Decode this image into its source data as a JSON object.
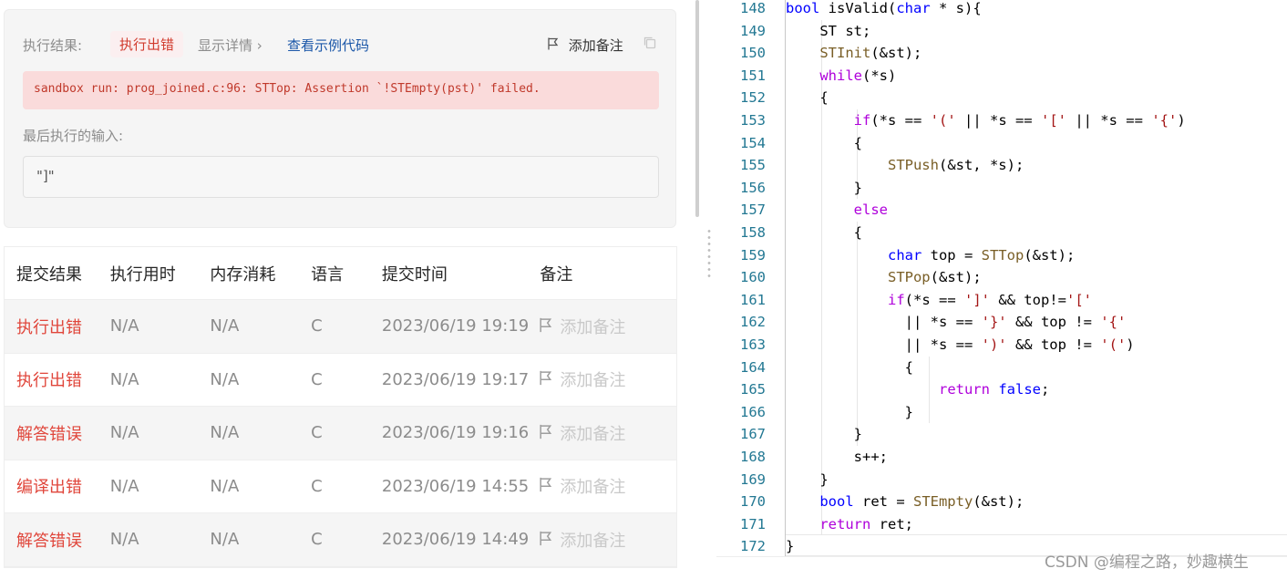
{
  "result": {
    "label": "执行结果:",
    "status": "执行出错",
    "detail": "显示详情",
    "example": "查看示例代码",
    "add_note": "添加备注",
    "error_message": "sandbox run: prog_joined.c:96: STTop: Assertion `!STEmpty(pst)' failed.",
    "last_input_label": "最后执行的输入:",
    "last_input_value": "\"]\""
  },
  "table": {
    "headers": [
      "提交结果",
      "执行用时",
      "内存消耗",
      "语言",
      "提交时间",
      "备注"
    ],
    "rows": [
      {
        "result": "执行出错",
        "time": "N/A",
        "memory": "N/A",
        "lang": "C",
        "submitted": "2023/06/19 19:19",
        "note": "添加备注"
      },
      {
        "result": "执行出错",
        "time": "N/A",
        "memory": "N/A",
        "lang": "C",
        "submitted": "2023/06/19 19:17",
        "note": "添加备注"
      },
      {
        "result": "解答错误",
        "time": "N/A",
        "memory": "N/A",
        "lang": "C",
        "submitted": "2023/06/19 19:16",
        "note": "添加备注"
      },
      {
        "result": "编译出错",
        "time": "N/A",
        "memory": "N/A",
        "lang": "C",
        "submitted": "2023/06/19 14:55",
        "note": "添加备注"
      },
      {
        "result": "解答错误",
        "time": "N/A",
        "memory": "N/A",
        "lang": "C",
        "submitted": "2023/06/19 14:49",
        "note": "添加备注"
      }
    ]
  },
  "editor": {
    "line_numbers": [
      "148",
      "149",
      "150",
      "151",
      "152",
      "153",
      "154",
      "155",
      "156",
      "157",
      "158",
      "159",
      "160",
      "161",
      "162",
      "163",
      "164",
      "165",
      "166",
      "167",
      "168",
      "169",
      "170",
      "171",
      "172"
    ],
    "lines": [
      "bool isValid(char * s){",
      "    ST st;",
      "    STInit(&st);",
      "    while(*s)",
      "    {",
      "        if(*s == '(' || *s == '[' || *s == '{')",
      "        {",
      "            STPush(&st, *s);",
      "        }",
      "        else",
      "        {",
      "            char top = STTop(&st);",
      "            STPop(&st);",
      "            if(*s == ']' && top!='['",
      "              || *s == '}' && top != '{'",
      "              || *s == ')' && top != '(')",
      "              {",
      "                  return false;",
      "              }",
      "        }",
      "        s++;",
      "    }",
      "    bool ret = STEmpty(&st);",
      "    return ret;",
      "}"
    ]
  },
  "watermark": "CSDN @编程之路，妙趣横生",
  "colors": {
    "error_red": "#e0463b",
    "error_bg": "#fadbdb",
    "link_blue": "#1a56a8",
    "keyword_blue": "#0000ff",
    "control_purple": "#af00db",
    "function_brown": "#795e26",
    "string_red": "#a31515",
    "line_number": "#237893"
  },
  "icons": {
    "flag": "flag-icon",
    "copy": "copy-icon",
    "chevron": "chevron-right-icon"
  }
}
